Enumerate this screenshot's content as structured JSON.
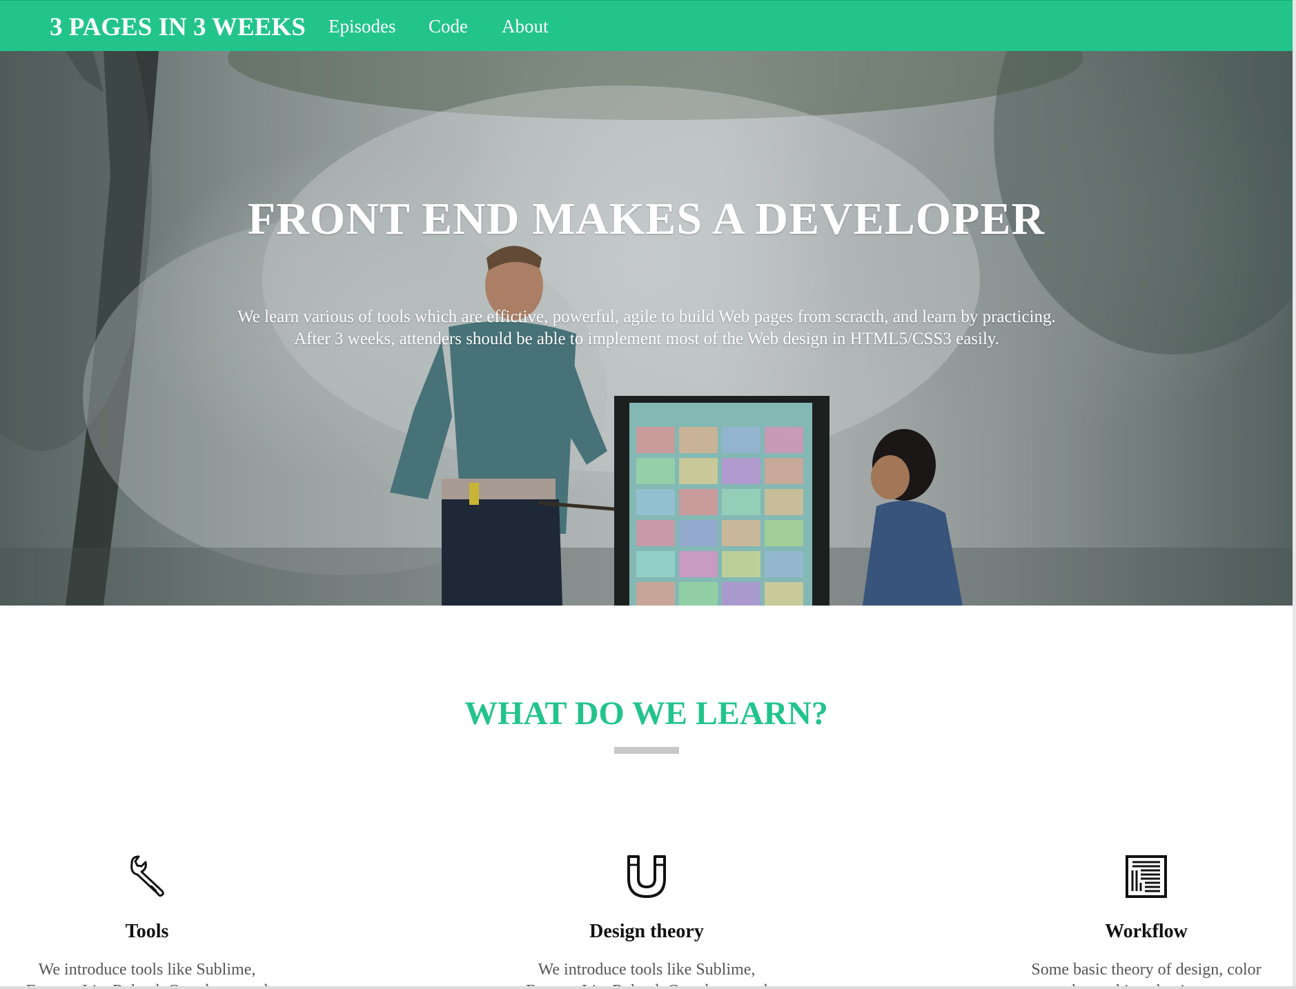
{
  "navbar": {
    "brand": "3 PAGES IN 3 WEEKS",
    "links": [
      {
        "label": "Episodes"
      },
      {
        "label": "Code"
      },
      {
        "label": "About"
      }
    ],
    "background_color": "#22c48b"
  },
  "hero": {
    "title": "FRONT END MAKES A DEVELOPER",
    "subtitle": "We learn various of tools which are effictive, powerful, agile to build Web pages from scracth, and learn by practicing. After 3 weeks, attenders should be able to implement most of the Web design in HTML5/CSS3 easily."
  },
  "learn": {
    "title": "WHAT DO WE LEARN?",
    "accent_color": "#22c48b",
    "features": [
      {
        "icon": "wrench-icon",
        "name": "Tools",
        "description": "We introduce tools like Sublime, Emmet, LiveReload, Guard to speed"
      },
      {
        "icon": "magnet-icon",
        "name": "Design theory",
        "description": "We introduce tools like Sublime, Emmet, LiveReload, Guard to speed"
      },
      {
        "icon": "layout-grid-icon",
        "name": "Workflow",
        "description": "Some basic theory of design, color scheme, hierachy, imagery"
      }
    ]
  }
}
